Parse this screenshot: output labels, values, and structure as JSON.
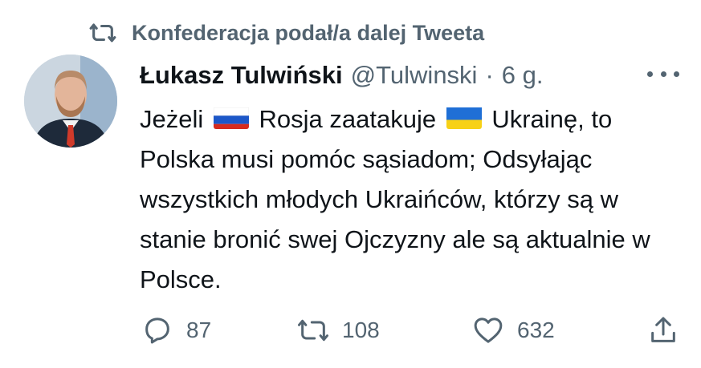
{
  "retweet_banner": {
    "text": "Konfederacja podał/a dalej Tweeta",
    "icon": "retweet-icon"
  },
  "tweet": {
    "author_name": "Łukasz Tulwiński",
    "handle": "@Tulwinski",
    "separator": "·",
    "time": "6 g.",
    "text_parts": {
      "p1": "Jeżeli",
      "p2": "Rosja zaatakuje",
      "p3": "Ukrainę, to Polska musi pomóc sąsiadom; Odsyłając wszystkich młodych Ukraińców, którzy są w stanie bronić swej Ojczyzny ale są aktualnie w Polsce."
    },
    "flags": [
      "russia-flag",
      "ukraine-flag"
    ]
  },
  "actions": {
    "replies": "87",
    "retweets": "108",
    "likes": "632"
  },
  "colors": {
    "secondary_text": "#536471",
    "primary_text": "#0f1419",
    "background": "#ffffff"
  }
}
